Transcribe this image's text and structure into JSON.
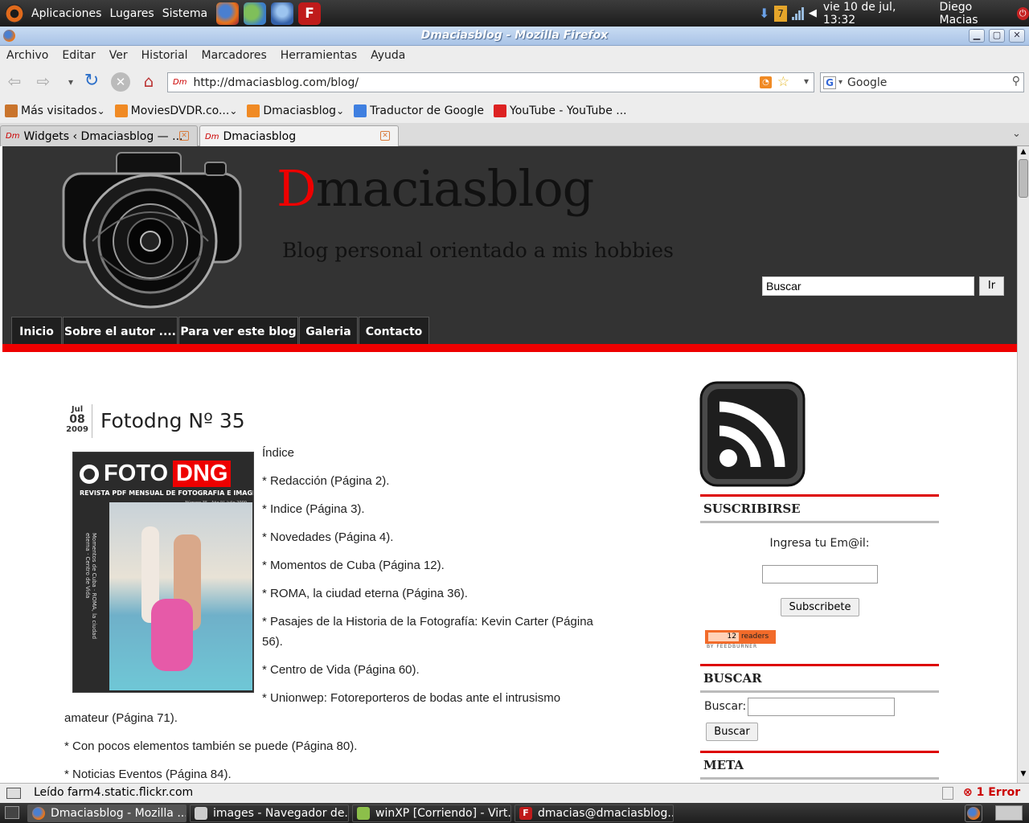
{
  "topbar": {
    "menus": [
      "Aplicaciones",
      "Lugares",
      "Sistema"
    ],
    "datetime": "vie 10 de jul, 13:32",
    "user": "Diego Macias",
    "tray_number": "7"
  },
  "window": {
    "title": "Dmaciasblog - Mozilla Firefox"
  },
  "menubar": {
    "items": [
      "Archivo",
      "Editar",
      "Ver",
      "Historial",
      "Marcadores",
      "Herramientas",
      "Ayuda"
    ]
  },
  "navbar": {
    "url": "http://dmaciasblog.com/blog/",
    "favicon_text": "Dm",
    "search_engine": "Google",
    "search_placeholder": "Google"
  },
  "bookmarks": [
    {
      "label": "Más visitados",
      "icon": "bookmarks-icon",
      "dropdown": true
    },
    {
      "label": "MoviesDVDR.co...",
      "icon": "rss-icon",
      "dropdown": true
    },
    {
      "label": "Dmaciasblog",
      "icon": "rss-icon",
      "dropdown": true
    },
    {
      "label": "Traductor de Google",
      "icon": "google-icon",
      "dropdown": false
    },
    {
      "label": "YouTube - YouTube ...",
      "icon": "youtube-icon",
      "dropdown": false
    }
  ],
  "tabs": [
    {
      "label": "Widgets ‹ Dmaciasblog — ...",
      "favicon": "Dm",
      "active": false
    },
    {
      "label": "Dmaciasblog",
      "favicon": "Dm",
      "active": true
    }
  ],
  "blog": {
    "title_first": "D",
    "title_rest": "maciasblog",
    "tagline": "Blog personal orientado a mis hobbies",
    "search_value": "Buscar",
    "search_button": "Ir",
    "nav": [
      "Inicio",
      "Sobre el autor ....",
      "Para ver este blog",
      "Galeria",
      "Contacto"
    ]
  },
  "post": {
    "date_month": "Jul",
    "date_day": "08",
    "date_year": "2009",
    "title": "Fotodng Nº 35",
    "cover": {
      "brand_foto": "FOTO",
      "brand_dng": "DNG",
      "subtitle": "REVISTA PDF MENSUAL DE FOTOGRAFIA E IMAGEN",
      "issue": "Número 35 · Año IV, Julio 2009",
      "side_text": "Momentos de Cuba · ROMA, la ciudad eterna · Centro de Vida"
    },
    "items": [
      "Índice",
      "* Redacción (Página 2).",
      "* Indice (Página 3).",
      "* Novedades (Página 4).",
      "* Momentos de Cuba (Página 12).",
      "* ROMA, la ciudad eterna (Página 36).",
      "* Pasajes de la Historia de la Fotografía: Kevin Carter (Página",
      "56).",
      "* Centro de Vida (Página 60).",
      "* Unionwep: Fotoreporteros de bodas ante el intrusismo",
      "amateur (Página 71).",
      "* Con pocos elementos también se puede (Página 80).",
      "* Noticias Eventos (Página 84)."
    ]
  },
  "sidebar": {
    "subscribe_title": "SUSCRIBIRSE",
    "email_label": "Ingresa tu Em@il:",
    "subscribe_button": "Subscribete",
    "feed_count": "12",
    "feed_readers": "readers",
    "feed_by": "BY FEEDBURNER",
    "search_title": "BUSCAR",
    "search_label": "Buscar:",
    "search_button": "Buscar",
    "meta_title": "META"
  },
  "statusbar": {
    "text": "Leído farm4.static.flickr.com",
    "error": "1 Error"
  },
  "taskbar": [
    {
      "label": "Dmaciasblog - Mozilla ...",
      "icon": "firefox-icon"
    },
    {
      "label": "images - Navegador de...",
      "icon": "folder-icon"
    },
    {
      "label": "winXP [Corriendo] - Virt...",
      "icon": "virtualbox-icon"
    },
    {
      "label": "dmacias@dmaciasblog....",
      "icon": "filezilla-icon"
    }
  ]
}
